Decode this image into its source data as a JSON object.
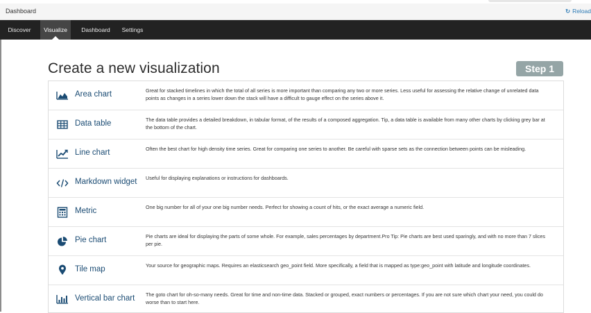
{
  "window": {
    "title": "Dashboard",
    "reload_label": "Reload",
    "reload_icon": "refresh-icon"
  },
  "nav": {
    "tabs": [
      {
        "label": "Discover",
        "active": false
      },
      {
        "label": "Visualize",
        "active": true
      },
      {
        "label": "Dashboard",
        "active": false
      },
      {
        "label": "Settings",
        "active": false
      }
    ]
  },
  "main": {
    "heading": "Create a new visualization",
    "step_badge": "Step 1",
    "accent_color": "#1a4b73",
    "badge_color": "#95a5a6",
    "visualizations": [
      {
        "icon": "area-chart-icon",
        "name": "Area chart",
        "description": "Great for stacked timelines in which the total of all series is more important than comparing any two or more series. Less useful for assessing the relative change of unrelated data points as changes in a series lower down the stack will have a difficult to gauge effect on the series above it."
      },
      {
        "icon": "table-icon",
        "name": "Data table",
        "description": "The data table provides a detailed breakdown, in tabular format, of the results of a composed aggregation. Tip, a data table is available from many other charts by clicking grey bar at the bottom of the chart."
      },
      {
        "icon": "line-chart-icon",
        "name": "Line chart",
        "description": "Often the best chart for high density time series. Great for comparing one series to another. Be careful with sparse sets as the connection between points can be misleading."
      },
      {
        "icon": "code-icon",
        "name": "Markdown widget",
        "description": "Useful for displaying explanations or instructions for dashboards."
      },
      {
        "icon": "calculator-icon",
        "name": "Metric",
        "description": "One big number for all of your one big number needs. Perfect for showing a count of hits, or the exact average a numeric field."
      },
      {
        "icon": "pie-chart-icon",
        "name": "Pie chart",
        "description": "Pie charts are ideal for displaying the parts of some whole. For example, sales percentages by department.Pro Tip: Pie charts are best used sparingly, and with no more than 7 slices per pie."
      },
      {
        "icon": "map-marker-icon",
        "name": "Tile map",
        "description": "Your source for geographic maps. Requires an elasticsearch geo_point field. More specifically, a field that is mapped as type:geo_point with latitude and longitude coordinates."
      },
      {
        "icon": "bar-chart-icon",
        "name": "Vertical bar chart",
        "description": "The goto chart for oh-so-many needs. Great for time and non-time data. Stacked or grouped, exact numbers or percentages. If you are not sure which chart your need, you could do worse than to start here."
      }
    ]
  }
}
